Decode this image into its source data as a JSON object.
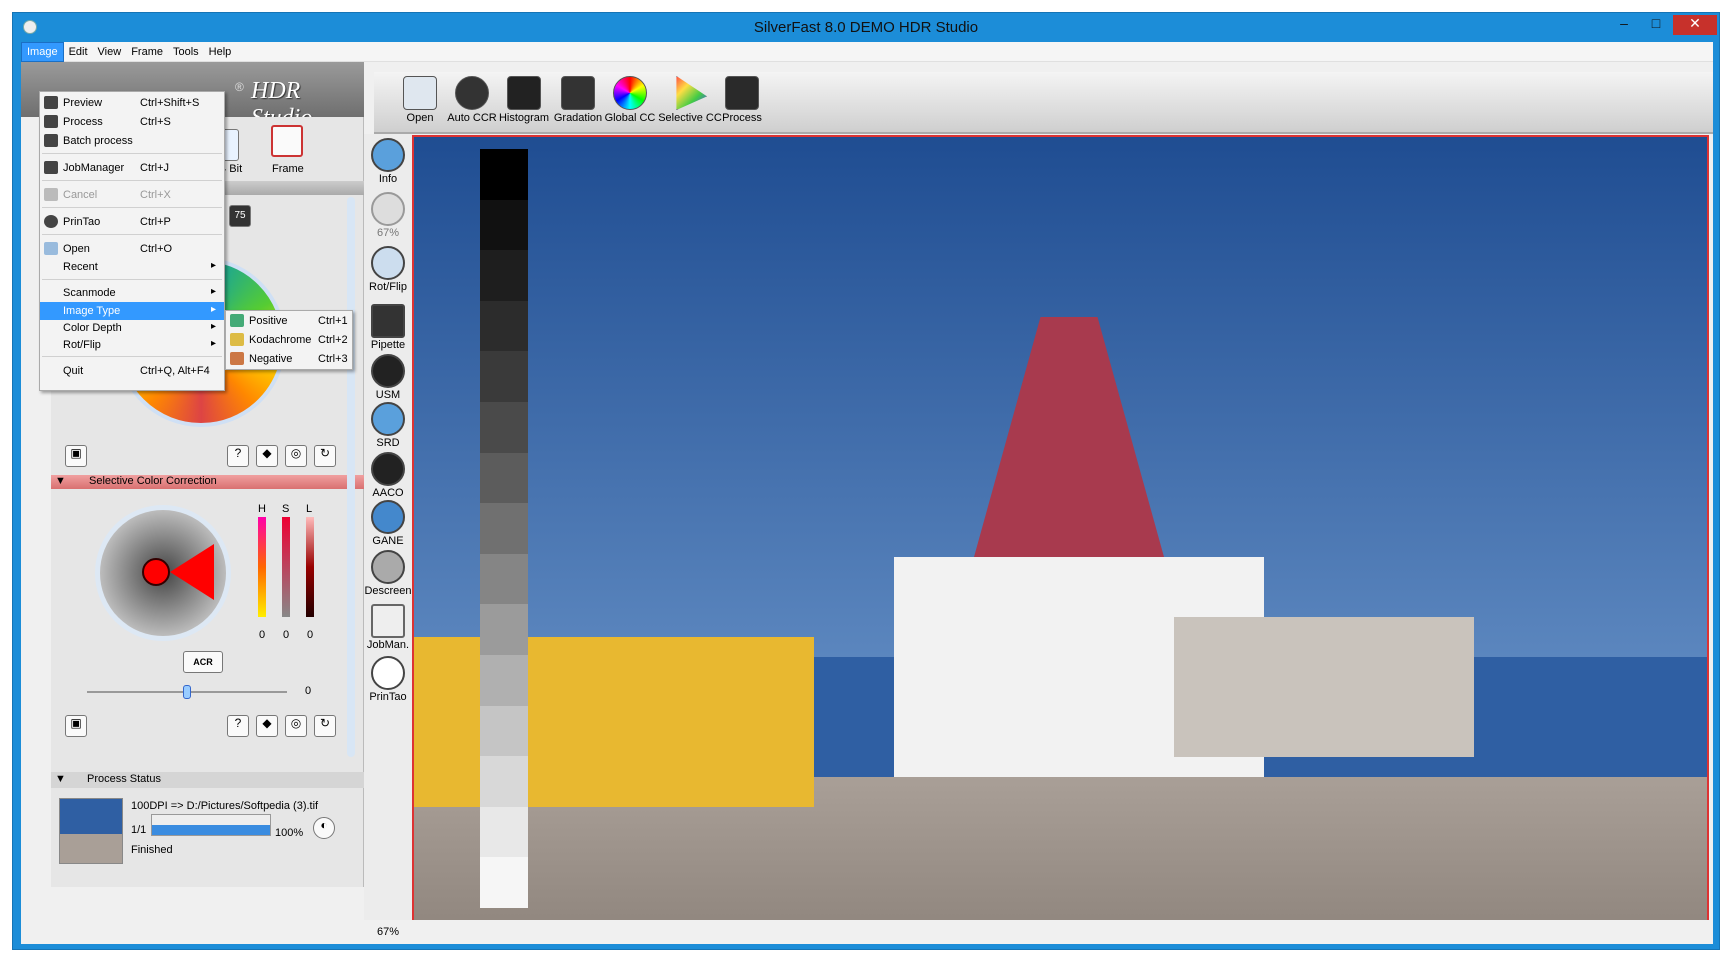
{
  "window": {
    "title": "SilverFast 8.0 DEMO  HDR Studio",
    "minimize": "–",
    "maximize": "□",
    "close": "✕"
  },
  "menubar": {
    "items": [
      "Image",
      "Edit",
      "View",
      "Frame",
      "Tools",
      "Help"
    ]
  },
  "app_header": {
    "title": "HDR Studio",
    "reg": "®"
  },
  "toolbar": {
    "items": [
      "Open",
      "Auto CCR",
      "Histogram",
      "Gradation",
      "Global CC",
      "Selective CC",
      "Process"
    ]
  },
  "side_tools": {
    "items": [
      "Info",
      "67%",
      "Rot/Flip",
      "Pipette",
      "USM",
      "SRD",
      "AACO",
      "GANE",
      "Descreen",
      "JobMan.",
      "PrinTao"
    ]
  },
  "image_menu": {
    "items": [
      {
        "label": "Preview",
        "shortcut": "Ctrl+Shift+S"
      },
      {
        "label": "Process",
        "shortcut": "Ctrl+S"
      },
      {
        "label": "Batch process",
        "shortcut": ""
      },
      {
        "label": "JobManager",
        "shortcut": "Ctrl+J"
      },
      {
        "label": "Cancel",
        "shortcut": "Ctrl+X"
      },
      {
        "label": "PrinTao",
        "shortcut": "Ctrl+P"
      },
      {
        "label": "Open",
        "shortcut": "Ctrl+O"
      },
      {
        "label": "Recent",
        "shortcut": ""
      },
      {
        "label": "Scanmode",
        "shortcut": ""
      },
      {
        "label": "Image Type",
        "shortcut": ""
      },
      {
        "label": "Color Depth",
        "shortcut": ""
      },
      {
        "label": "Rot/Flip",
        "shortcut": ""
      },
      {
        "label": "Quit",
        "shortcut": "Ctrl+Q, Alt+F4"
      }
    ]
  },
  "image_type_submenu": {
    "items": [
      {
        "label": "Positive",
        "shortcut": "Ctrl+1"
      },
      {
        "label": "Kodachrome",
        "shortcut": "Ctrl+2"
      },
      {
        "label": "Negative",
        "shortcut": "Ctrl+3"
      }
    ]
  },
  "panel": {
    "mode_buttons": [
      "24 Bit",
      "Frame"
    ],
    "value_box": "75",
    "selective_color_title": "Selective Color Correction",
    "hsl_labels": [
      "H",
      "S",
      "L"
    ],
    "hsl_values": [
      "0",
      "0",
      "0"
    ],
    "acr_label": "ACR",
    "slider_value": "0"
  },
  "process_status": {
    "title": "Process Status",
    "job": "100DPI => D:/Pictures/Softpedia (3).tif",
    "count": "1/1",
    "progress_label": "100%",
    "progress": 1.0,
    "state": "Finished"
  },
  "statusbar": {
    "zoom": "67%"
  }
}
